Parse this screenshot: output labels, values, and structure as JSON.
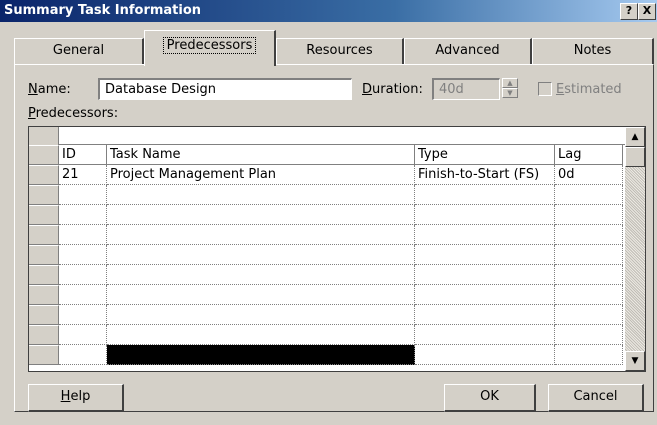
{
  "window": {
    "title": "Summary Task Information",
    "help_btn": "?",
    "close_btn": "X"
  },
  "tabs": [
    {
      "label": "General"
    },
    {
      "label": "Predecessors"
    },
    {
      "label": "Resources"
    },
    {
      "label": "Advanced"
    },
    {
      "label": "Notes"
    }
  ],
  "form": {
    "name_label_u": "N",
    "name_label_rest": "ame:",
    "name_value": "Database Design",
    "duration_label_u": "D",
    "duration_label_rest": "uration:",
    "duration_value": "40d",
    "estimated_label_u": "E",
    "estimated_label_rest": "stimated",
    "predecessors_label_u": "P",
    "predecessors_label_rest": "redecessors:"
  },
  "table": {
    "headers": [
      "ID",
      "Task Name",
      "Type",
      "Lag"
    ],
    "rows": [
      [
        "21",
        "Project Management Plan",
        "Finish-to-Start (FS)",
        "0d"
      ]
    ]
  },
  "buttons": {
    "help_u": "H",
    "help_rest": "elp",
    "ok": "OK",
    "cancel": "Cancel"
  },
  "scrollbar": {
    "up_arrow": "▲",
    "down_arrow": "▼"
  },
  "spinner": {
    "up_arrow": "▲",
    "down_arrow": "▼"
  }
}
